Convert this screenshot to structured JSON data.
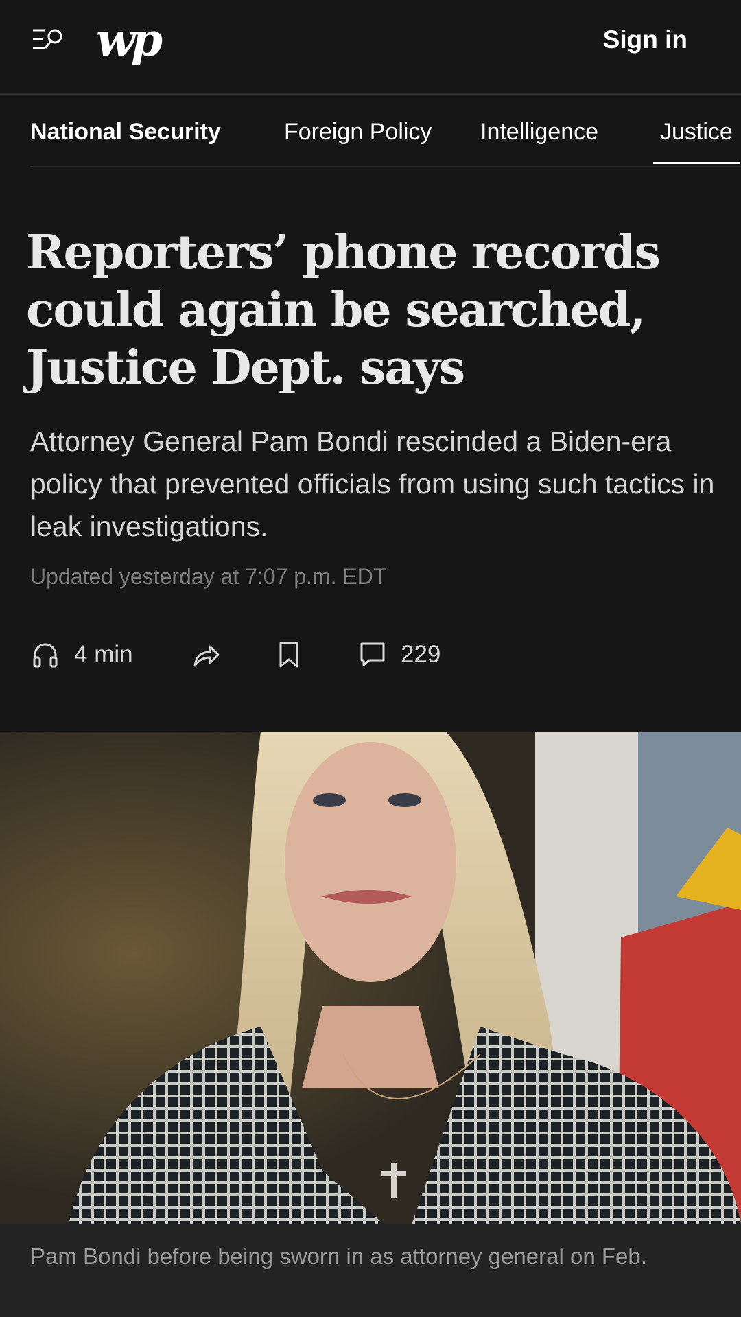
{
  "header": {
    "logo_text": "wp",
    "signin_label": "Sign in"
  },
  "subnav": {
    "section_title": "National Security",
    "tabs": [
      {
        "label": "Foreign Policy"
      },
      {
        "label": "Intelligence"
      },
      {
        "label": "Justice"
      }
    ],
    "active_tab": "Justice"
  },
  "article": {
    "headline": "Reporters’ phone records could again be searched, Justice Dept. says",
    "dek": "Attorney General Pam Bondi rescinded a Biden-era policy that prevented officials from using such tactics in leak investigations.",
    "timestamp": "Updated yesterday at 7:07 p.m. EDT",
    "actions": {
      "listen_duration": "4 min",
      "comment_count": "229"
    },
    "photo": {
      "caption": "Pam Bondi before being sworn in as attorney general on Feb."
    }
  },
  "icons": {
    "menu": "menu-search-icon",
    "listen": "headphones-icon",
    "share": "share-arrow-icon",
    "save": "bookmark-icon",
    "comments": "comment-icon"
  }
}
